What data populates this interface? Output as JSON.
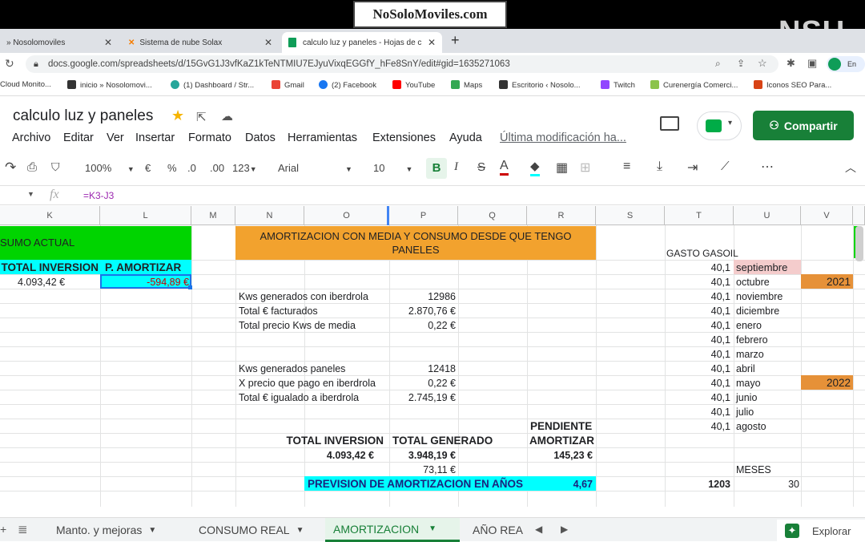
{
  "watermark": "NoSoloMoviles.com",
  "watermark_corner": "NSU",
  "browser": {
    "tabs": [
      {
        "label": "» Nosolomoviles"
      },
      {
        "label": "Sistema de nube Solax"
      },
      {
        "label": "calculo luz y paneles - Hojas de c"
      }
    ],
    "url": "docs.google.com/spreadsheets/d/15GvG1J3vfKaZ1kTeNTMIU7EJyuVixqEGGfY_hFe8SnY/edit#gid=1635271063",
    "profile_label": "En pa",
    "bookmarks": [
      "Cloud Monito...",
      "inicio » Nosolomovi...",
      "(1) Dashboard / Str...",
      "Gmail",
      "(2) Facebook",
      "YouTube",
      "Maps",
      "Escritorio ‹ Nosolo...",
      "Twitch",
      "Curenergía Comerci...",
      "Iconos SEO Para..."
    ]
  },
  "doc": {
    "title": "calculo luz y paneles",
    "menus": [
      "Archivo",
      "Editar",
      "Ver",
      "Insertar",
      "Formato",
      "Datos",
      "Herramientas",
      "Extensiones",
      "Ayuda"
    ],
    "last_edit": "Última modificación ha...",
    "share_label": "Compartir",
    "explore_label": "Explorar"
  },
  "toolbar": {
    "zoom": "100%",
    "currency": "€",
    "percent": "%",
    "dec_less": ".0",
    "dec_more": ".00",
    "number_format": "123",
    "font": "Arial",
    "font_size": "10",
    "bold": "B",
    "italic": "I",
    "strike": "S",
    "textcolor": "A",
    "more": "⋯"
  },
  "formula_bar": {
    "fx": "fx",
    "formula": "=K3-J3"
  },
  "columns": [
    "K",
    "L",
    "M",
    "N",
    "O",
    "P",
    "Q",
    "R",
    "S",
    "T",
    "U",
    "V"
  ],
  "cells": {
    "consumo_actual": "SUMO ACTUAL",
    "amortizacion_header": "AMORTIZACION CON MEDIA Y CONSUMO DESDE QUE TENGO PANELES",
    "total_inversion_label": "TOTAL INVERSION",
    "p_amortizar_label": "P. AMORTIZAR",
    "total_inversion_value": "4.093,42 €",
    "p_amortizar_value": "-594,89 €",
    "gasto_gasoil": "GASTO GASOIL",
    "kws_iberdrola_label": "Kws generados con iberdrola",
    "kws_iberdrola_value": "12986",
    "total_facturados_label": "Total € facturados",
    "total_facturados_value": "2.870,76 €",
    "precio_media_label": "Total precio Kws de media",
    "precio_media_value": "0,22 €",
    "kws_paneles_label": "Kws generados paneles",
    "kws_paneles_value": "12418",
    "precio_pago_label": "X precio que pago en iberdrola",
    "precio_pago_value": "0,22 €",
    "igualado_label": "Total € igualado a iberdrola",
    "igualado_value": "2.745,19 €",
    "sum_inversion_label": "TOTAL INVERSION",
    "sum_generado_label": "TOTAL GENERADO",
    "pendiente_label_1": "PENDIENTE",
    "pendiente_label_2": "AMORTIZAR",
    "sum_inversion_value": "4.093,42 €",
    "sum_generado_value": "3.948,19 €",
    "pendiente_value": "145,23 €",
    "extra_value": "73,11 €",
    "prevision_label": "PREVISION DE AMORTIZACION EN AÑOS",
    "prevision_value": "4,67",
    "meses_label": "MESES",
    "total_gasoil": "1203",
    "meses_value": "30"
  },
  "gasoil": [
    {
      "amount": "40,1",
      "month": "septiembre",
      "year": ""
    },
    {
      "amount": "40,1",
      "month": "octubre",
      "year": "2021"
    },
    {
      "amount": "40,1",
      "month": "noviembre",
      "year": ""
    },
    {
      "amount": "40,1",
      "month": "diciembre",
      "year": ""
    },
    {
      "amount": "40,1",
      "month": "enero",
      "year": ""
    },
    {
      "amount": "40,1",
      "month": "febrero",
      "year": ""
    },
    {
      "amount": "40,1",
      "month": "marzo",
      "year": ""
    },
    {
      "amount": "40,1",
      "month": "abril",
      "year": ""
    },
    {
      "amount": "40,1",
      "month": "mayo",
      "year": "2022"
    },
    {
      "amount": "40,1",
      "month": "junio",
      "year": ""
    },
    {
      "amount": "40,1",
      "month": "julio",
      "year": ""
    },
    {
      "amount": "40,1",
      "month": "agosto",
      "year": ""
    }
  ],
  "sheet_tabs": [
    "Manto. y mejoras",
    "CONSUMO REAL",
    "AMORTIZACION",
    "AÑO REA"
  ],
  "colors": {
    "green": "#00d400",
    "orange": "#f2a22e",
    "cyan": "#00ffff",
    "pink": "#f4cccc",
    "year_orange": "#e69138",
    "share_green": "#188038"
  }
}
